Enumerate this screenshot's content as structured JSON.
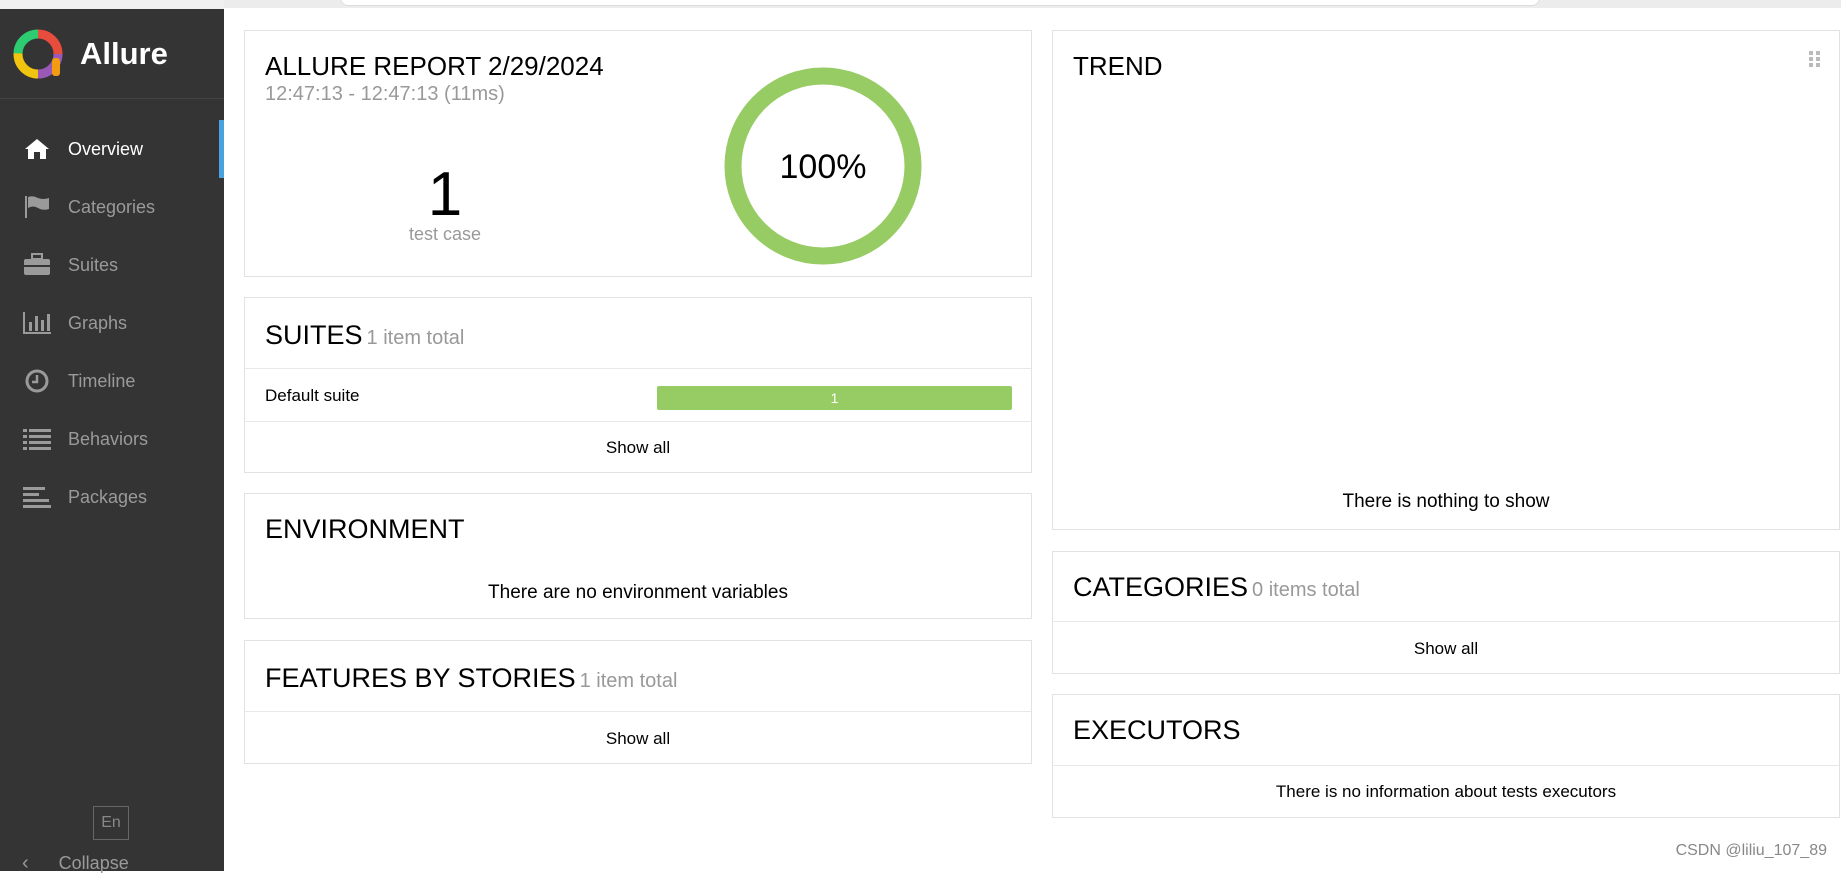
{
  "brand": {
    "name": "Allure"
  },
  "nav": [
    {
      "id": "overview",
      "label": "Overview",
      "icon": "home-icon",
      "active": true
    },
    {
      "id": "categories",
      "label": "Categories",
      "icon": "flag-icon",
      "active": false
    },
    {
      "id": "suites",
      "label": "Suites",
      "icon": "briefcase-icon",
      "active": false
    },
    {
      "id": "graphs",
      "label": "Graphs",
      "icon": "bar-chart-icon",
      "active": false
    },
    {
      "id": "timeline",
      "label": "Timeline",
      "icon": "clock-icon",
      "active": false
    },
    {
      "id": "behaviors",
      "label": "Behaviors",
      "icon": "list-icon",
      "active": false
    },
    {
      "id": "packages",
      "label": "Packages",
      "icon": "align-left-icon",
      "active": false
    }
  ],
  "sidebar_footer": {
    "language": "En",
    "collapse_label": "Collapse"
  },
  "summary": {
    "title": "ALLURE REPORT 2/29/2024",
    "time": "12:47:13 - 12:47:13 (11ms)",
    "test_count": "1",
    "test_label": "test case",
    "percent": "100%",
    "pass_rate": 1.0,
    "pass_color": "#97cc64"
  },
  "suites": {
    "title": "SUITES",
    "subtitle": "1 item total",
    "items": [
      {
        "name": "Default suite",
        "passed": "1"
      }
    ],
    "show_all": "Show all"
  },
  "environment": {
    "title": "ENVIRONMENT",
    "empty": "There are no environment variables"
  },
  "features": {
    "title": "FEATURES BY STORIES",
    "subtitle": "1 item total",
    "show_all": "Show all"
  },
  "trend": {
    "title": "TREND",
    "empty": "There is nothing to show"
  },
  "categories": {
    "title": "CATEGORIES",
    "subtitle": "0 items total",
    "show_all": "Show all"
  },
  "executors": {
    "title": "EXECUTORS",
    "empty": "There is no information about tests executors"
  },
  "watermark": "CSDN @liliu_107_89",
  "colors": {
    "sidebar_bg": "#343434",
    "active_indicator": "#4aa3df",
    "passed": "#97cc64"
  }
}
